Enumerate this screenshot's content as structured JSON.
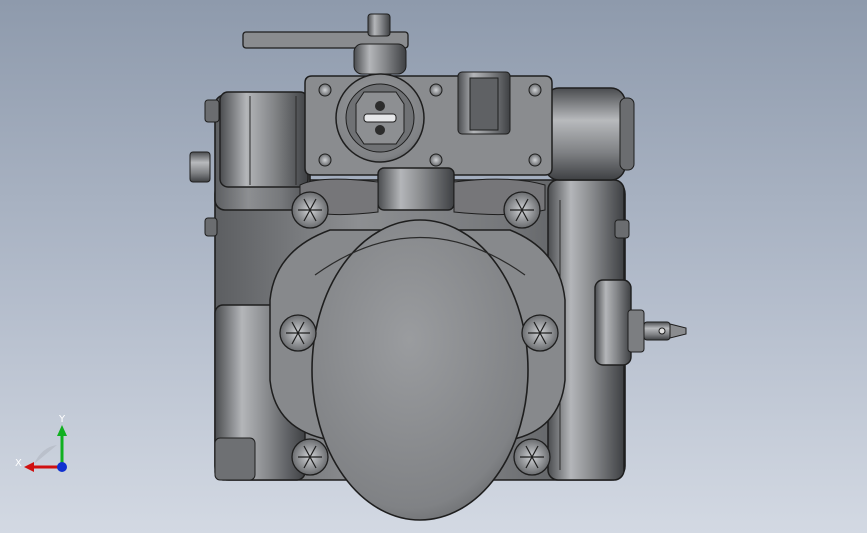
{
  "viewport": {
    "background_top": "#8e9aac",
    "background_bottom": "#d3d9e3"
  },
  "model": {
    "body_color": "#7d7f82",
    "edge_color": "#1e1e1e",
    "highlight_color": "#c9cbce",
    "bolt_heads": 6
  },
  "triad": {
    "x_label": "X",
    "y_label": "Y",
    "x_color": "#d01010",
    "y_color": "#10b020",
    "z_color": "#1030d0"
  }
}
